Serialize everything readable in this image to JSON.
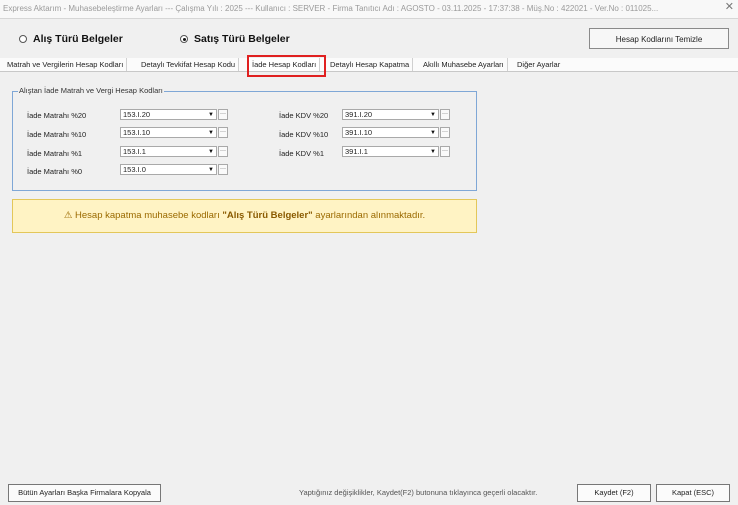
{
  "window": {
    "title": "Express Aktarım - Muhasebeleştirme Ayarları --- Çalışma Yılı : 2025 --- Kullanıcı : SERVER - Firma Tanıtıcı Adı : AGOSTO - 03.11.2025 - 17:37:38 - Müş.No : 422021 - Ver.No : 011025...",
    "close": "✕"
  },
  "mode": {
    "options": [
      {
        "label": "Alış Türü Belgeler",
        "selected": false
      },
      {
        "label": "Satış Türü Belgeler",
        "selected": true
      }
    ],
    "clear_button": "Hesap Kodlarını Temizle"
  },
  "tabs": [
    {
      "label": "Matrah ve Vergilerin Hesap Kodları",
      "active": false
    },
    {
      "label": "Detaylı Tevkifat Hesap Kodu",
      "active": false
    },
    {
      "label": "İade Hesap Kodları",
      "active": true
    },
    {
      "label": "Detaylı Hesap Kapatma",
      "active": false
    },
    {
      "label": "Akıllı Muhasebe Ayarları",
      "active": false
    },
    {
      "label": "Diğer Ayarlar",
      "active": false
    }
  ],
  "group": {
    "title": "Alıştan İade Matrah ve Vergi Hesap Kodları",
    "left": [
      {
        "label": "İade Matrahı %20",
        "value": "153.I.20"
      },
      {
        "label": "İade Matrahı %10",
        "value": "153.I.10"
      },
      {
        "label": "İade Matrahı %1",
        "value": "153.I.1"
      },
      {
        "label": "İade Matrahı %0",
        "value": "153.I.0"
      }
    ],
    "right": [
      {
        "label": "İade KDV %20",
        "value": "391.I.20"
      },
      {
        "label": "İade KDV %10",
        "value": "391.I.10"
      },
      {
        "label": "İade KDV %1",
        "value": "391.I.1"
      }
    ],
    "dropdown_glyph": "▼",
    "ellipsis_glyph": "···"
  },
  "notice": {
    "icon": "⚠",
    "prefix": "Hesap kapatma muhasebe kodları ",
    "bold": "\"Alış Türü Belgeler\"",
    "suffix": " ayarlarından alınmaktadır."
  },
  "footer": {
    "copy_button": "Bütün Ayarları Başka Firmalara Kopyala",
    "hint": "Yaptığınız değişiklikler, Kaydet(F2) butonuna tıklayınca geçerli olacaktır.",
    "save_button": "Kaydet (F2)",
    "close_button": "Kapat (ESC)"
  },
  "colors": {
    "highlight": "#e02020",
    "notice_bg": "#fff3c4",
    "group_border": "#7fa7d6"
  }
}
